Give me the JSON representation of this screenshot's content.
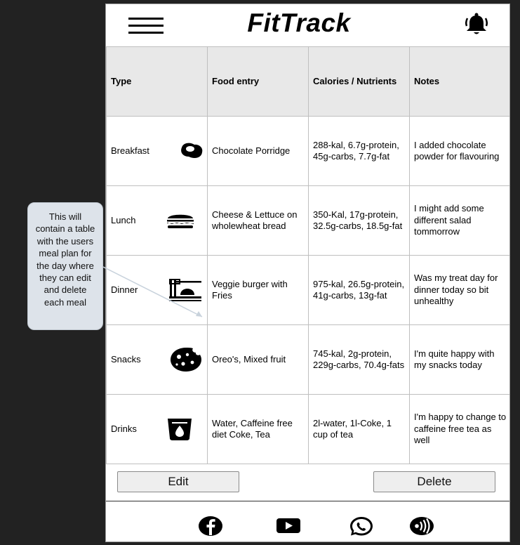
{
  "app": {
    "title": "FitTrack"
  },
  "icons": {
    "menu": "hamburger-menu-icon",
    "notifications": "bell-icon",
    "breakfast": "fried-egg-icon",
    "lunch": "burger-icon",
    "dinner": "noodles-bowl-icon",
    "snacks": "cookie-icon",
    "drinks": "drink-cup-icon",
    "social": [
      "facebook-icon",
      "youtube-icon",
      "whatsapp-icon",
      "broadcast-icon"
    ]
  },
  "table": {
    "headers": [
      "Type",
      "Food entry",
      "Calories / Nutrients",
      "Notes"
    ],
    "rows": [
      {
        "type": "Breakfast",
        "food": "Chocolate Porridge",
        "nutrients": "288-kal, 6.7g-protein,  45g-carbs, 7.7g-fat",
        "notes": "I added chocolate powder for flavouring"
      },
      {
        "type": "Lunch",
        "food": "Cheese & Lettuce on wholewheat bread",
        "nutrients": "350-Kal, 17g-protein, 32.5g-carbs, 18.5g-fat",
        "notes": "I might add some different salad tommorrow"
      },
      {
        "type": "Dinner",
        "food": "Veggie burger with Fries",
        "nutrients": "975-kal, 26.5g-protein, 41g-carbs, 13g-fat",
        "notes": "Was my treat day for dinner today so bit unhealthy"
      },
      {
        "type": "Snacks",
        "food": "Oreo's, Mixed fruit",
        "nutrients": "745-kal, 2g-protein, 229g-carbs, 70.4g-fats",
        "notes": "I'm quite happy with my snacks today"
      },
      {
        "type": "Drinks",
        "food": "Water, Caffeine free diet Coke, Tea",
        "nutrients": "2l-water, 1l-Coke, 1 cup of tea",
        "notes": "I'm happy to change to caffeine free tea as well"
      }
    ]
  },
  "actions": {
    "edit": "Edit",
    "delete": "Delete"
  },
  "annotation": {
    "text": "This will contain a table with the users meal plan for the day where they can edit and delete each meal"
  },
  "colors": {
    "background": "#222222",
    "header_fill": "#e8e8e8",
    "callout_fill": "#dde3ea",
    "button_fill": "#eeeeee"
  }
}
